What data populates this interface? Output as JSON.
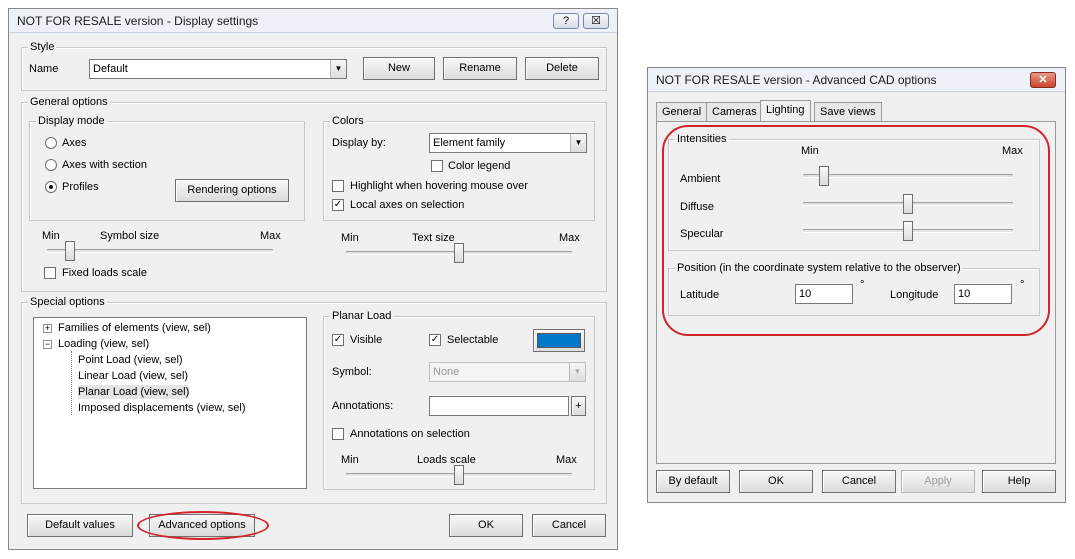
{
  "display_window": {
    "title": "NOT FOR RESALE version - Display settings",
    "help_label": "?",
    "close_label": "☒",
    "style": {
      "group_label": "Style",
      "name_label": "Name",
      "name_value": "Default",
      "new_label": "New",
      "rename_label": "Rename",
      "delete_label": "Delete"
    },
    "general": {
      "group_label": "General options",
      "display_mode": {
        "group_label": "Display mode",
        "options": [
          "Axes",
          "Axes with section",
          "Profiles"
        ],
        "selected": "Profiles",
        "rendering_label": "Rendering options"
      },
      "colors": {
        "group_label": "Colors",
        "display_by_label": "Display by:",
        "display_by_value": "Element family",
        "color_legend_label": "Color legend",
        "color_legend_checked": false,
        "highlight_label": "Highlight when hovering mouse over",
        "highlight_checked": false,
        "local_axes_label": "Local axes on selection",
        "local_axes_checked": true
      },
      "symbol_size": {
        "min": "Min",
        "label": "Symbol size",
        "max": "Max",
        "level": 0.1
      },
      "text_size": {
        "min": "Min",
        "label": "Text size",
        "max": "Max",
        "level": 0.5
      },
      "fixed_loads_label": "Fixed loads scale",
      "fixed_loads_checked": false
    },
    "special": {
      "group_label": "Special options",
      "tree": {
        "families_label": "Families of elements (view, sel)",
        "loading_label": "Loading (view, sel)",
        "children": [
          "Point Load (view, sel)",
          "Linear Load (view, sel)",
          "Planar Load (view, sel)",
          "Imposed displacements (view, sel)"
        ],
        "selected": "Planar Load (view, sel)"
      },
      "planar": {
        "group_label": "Planar Load",
        "visible_label": "Visible",
        "visible_checked": true,
        "selectable_label": "Selectable",
        "selectable_checked": true,
        "swatch_color": "#0078c8",
        "symbol_label": "Symbol:",
        "symbol_value": "None",
        "annotations_label": "Annotations:",
        "annotations_value": "",
        "plus_label": "+",
        "ann_on_sel_label": "Annotations on selection",
        "ann_on_sel_checked": false,
        "loads_scale": {
          "min": "Min",
          "label": "Loads scale",
          "max": "Max",
          "level": 0.5
        }
      }
    },
    "footer": {
      "default_values_label": "Default values",
      "advanced_label": "Advanced options",
      "ok_label": "OK",
      "cancel_label": "Cancel"
    },
    "highlight_color": "#d2232a"
  },
  "cad_window": {
    "title": "NOT FOR RESALE version - Advanced CAD options",
    "close_label": "✕",
    "tabs": [
      "General",
      "Cameras",
      "Lighting",
      "Save views"
    ],
    "active_tab": "Lighting",
    "intensities": {
      "group_label": "Intensities",
      "min_label": "Min",
      "max_label": "Max",
      "sliders": [
        {
          "label": "Ambient",
          "level": 0.1
        },
        {
          "label": "Diffuse",
          "level": 0.5
        },
        {
          "label": "Specular",
          "level": 0.5
        }
      ]
    },
    "position": {
      "group_label": "Position (in the coordinate system relative to the observer)",
      "latitude_label": "Latitude",
      "latitude_value": "10",
      "longitude_label": "Longitude",
      "longitude_value": "10",
      "degree_symbol": "°"
    },
    "footer": {
      "by_default_label": "By default",
      "ok_label": "OK",
      "cancel_label": "Cancel",
      "apply_label": "Apply",
      "help_label": "Help"
    }
  }
}
